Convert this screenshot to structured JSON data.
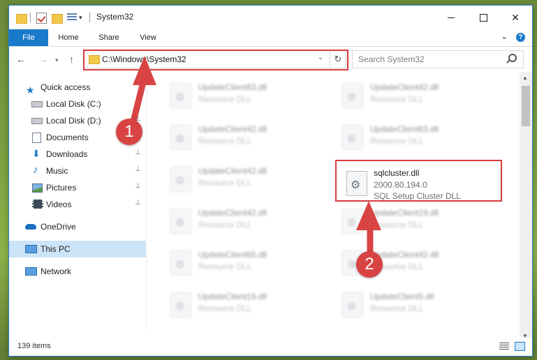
{
  "window": {
    "title": "System32"
  },
  "ribbon": {
    "file": "File",
    "home": "Home",
    "share": "Share",
    "view": "View"
  },
  "nav": {
    "address": "C:\\Windows\\System32",
    "search_placeholder": "Search System32"
  },
  "sidebar": {
    "items": [
      {
        "label": "Quick access",
        "icon": "star-icon"
      },
      {
        "label": "Local Disk (C:)",
        "icon": "drive-icon"
      },
      {
        "label": "Local Disk (D:)",
        "icon": "drive-icon"
      },
      {
        "label": "Documents",
        "icon": "documents-icon"
      },
      {
        "label": "Downloads",
        "icon": "downloads-icon"
      },
      {
        "label": "Music",
        "icon": "music-icon"
      },
      {
        "label": "Pictures",
        "icon": "pictures-icon"
      },
      {
        "label": "Videos",
        "icon": "videos-icon"
      },
      {
        "label": "OneDrive",
        "icon": "onedrive-icon"
      },
      {
        "label": "This PC",
        "icon": "computer-icon"
      },
      {
        "label": "Network",
        "icon": "network-icon"
      }
    ]
  },
  "files": [
    {
      "name": "UpdateClient63.dll",
      "desc": "Resource DLL"
    },
    {
      "name": "UpdateClient42.dll",
      "desc": "Resource DLL"
    },
    {
      "name": "UpdateClient42.dll",
      "desc": "Resource DLL"
    },
    {
      "name": "UpdateClient63.dll",
      "desc": "Resource DLL"
    },
    {
      "name": "UpdateClient42.dll",
      "desc": "Resource DLL"
    },
    {
      "name": "UpdateClient42.dll",
      "desc": "Resource DLL"
    },
    {
      "name": "UpdateClient19.dll",
      "desc": "Resource DLL"
    },
    {
      "name": "UpdateClient65.dll",
      "desc": "Resource DLL"
    },
    {
      "name": "UpdateClient42.dll",
      "desc": "Resource DLL"
    },
    {
      "name": "UpdateClient19.dll",
      "desc": "Resource DLL"
    },
    {
      "name": "UpdateClient5.dll",
      "desc": "Resource DLL"
    }
  ],
  "highlighted_file": {
    "name": "sqlcluster.dll",
    "version": "2000.80.194.0",
    "desc": "SQL Setup Cluster DLL"
  },
  "status": {
    "items": "139 items"
  },
  "callouts": {
    "one": "1",
    "two": "2"
  },
  "colors": {
    "accent": "#1979ca",
    "highlight": "#d83b3b"
  }
}
